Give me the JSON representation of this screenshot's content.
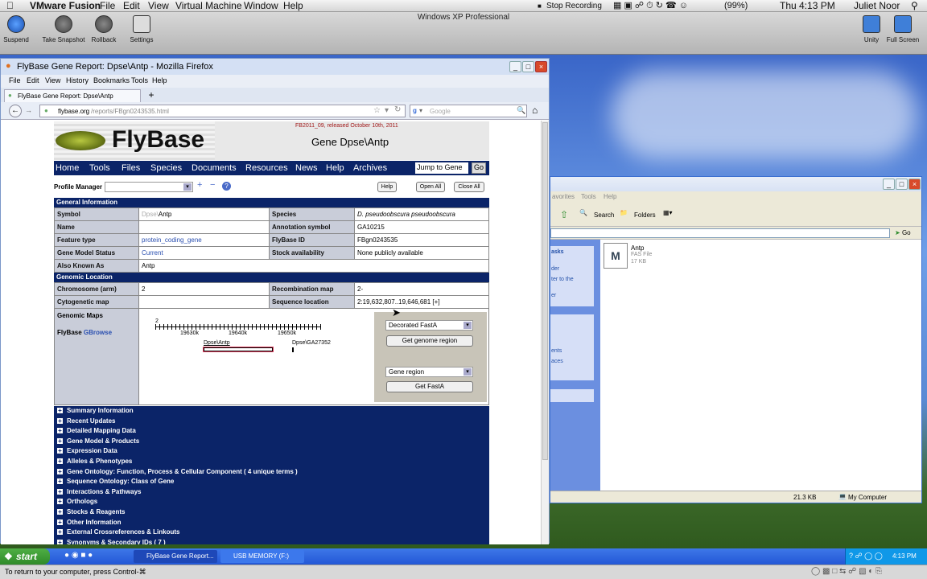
{
  "mac_menu": [
    "VMware Fusion",
    "File",
    "Edit",
    "View",
    "Virtual Machine",
    "Window",
    "Help"
  ],
  "mac_status": {
    "stop_recording": "Stop Recording",
    "battery": "(99%)",
    "clock": "Thu 4:13 PM",
    "user": "Juliet Noor"
  },
  "vm_title": "Windows XP Professional",
  "vm_toolbar": {
    "suspend": "Suspend",
    "snapshot": "Take Snapshot",
    "rollback": "Rollback",
    "settings": "Settings",
    "unity": "Unity",
    "fullscreen": "Full Screen"
  },
  "firefox": {
    "title": "FlyBase Gene Report: Dpse\\Antp - Mozilla Firefox",
    "menu": [
      "File",
      "Edit",
      "View",
      "History",
      "Bookmarks",
      "Tools",
      "Help"
    ],
    "tab": "FlyBase Gene Report: Dpse\\Antp",
    "url_host": "flybase.org",
    "url_path": "/reports/FBgn0243535.html",
    "search_placeholder": "Google"
  },
  "flybase": {
    "logo": "FlyBase",
    "release": "FB2011_09, released October 10th, 2011",
    "gene_title": "Gene Dpse\\Antp",
    "nav": [
      "Home",
      "Tools",
      "Files",
      "Species",
      "Documents",
      "Resources",
      "News",
      "Help",
      "Archives"
    ],
    "jump_to_gene": "Jump to Gene",
    "go": "Go",
    "profile_manager": "Profile Manager",
    "help_btn": "Help",
    "open_all": "Open All",
    "close_all": "Close All",
    "general_info": "General Information",
    "rows": [
      {
        "l1": "Symbol",
        "v1a": "Dpse\\",
        "v1b": "Antp",
        "l2": "Species",
        "v2": "D. pseudoobscura pseudoobscura"
      },
      {
        "l1": "Name",
        "v1a": "",
        "v1b": "",
        "l2": "Annotation symbol",
        "v2": "GA10215"
      },
      {
        "l1": "Feature type",
        "v1a": "protein_coding_gene",
        "v1b": "",
        "l2": "FlyBase ID",
        "v2": "FBgn0243535"
      },
      {
        "l1": "Gene Model Status",
        "v1a": "Current",
        "v1b": "",
        "l2": "Stock availability",
        "v2": "None publicly available"
      }
    ],
    "also_known_as_label": "Also Known As",
    "also_known_as": "Antp",
    "genomic_location": "Genomic Location",
    "chrom_label": "Chromosome (arm)",
    "chrom": "2",
    "recomb_label": "Recombination map",
    "recomb": "2-",
    "cyto_label": "Cytogenetic map",
    "seqloc_label": "Sequence location",
    "seqloc": "2:19,632,807..19,646,681 [+]",
    "genomic_maps": "Genomic Maps",
    "flybase_label": "FlyBase ",
    "gbrowse": "GBrowse",
    "map_chrom": "2",
    "ticks": [
      "19630k",
      "19640k",
      "19650k"
    ],
    "gene1": "Dpse\\Antp",
    "gene2": "Dpse\\GA27352",
    "select1": "Decorated FastA",
    "btn_genome_region": "Get genome region",
    "select2": "Gene region",
    "btn_getfasta": "Get FastA",
    "sections": [
      "Summary Information",
      "Recent Updates",
      "Detailed Mapping Data",
      "Gene Model & Products",
      "Expression Data",
      "Alleles & Phenotypes",
      "Gene Ontology: Function, Process & Cellular Component ( 4 unique terms )",
      "Sequence Ontology: Class of Gene",
      "Interactions & Pathways",
      "Orthologs",
      "Stocks & Reagents",
      "Other Information",
      "External Crossreferences & Linkouts",
      "Synonyms & Secondary IDs ( 7 )"
    ]
  },
  "explorer": {
    "menu_partial": [
      "avorites",
      "Tools",
      "Help"
    ],
    "search": "Search",
    "folders": "Folders",
    "go": "Go",
    "side_partial": [
      "asks",
      "der",
      "ter to the",
      "er",
      "ents",
      "aces"
    ],
    "file_name": "Antp",
    "file_type": "FAS File",
    "file_size": "17 KB",
    "status_size": "21.3 KB",
    "status_loc": "My Computer"
  },
  "taskbar": {
    "start": "start",
    "items": [
      "FlyBase Gene Report...",
      "USB MEMORY (F:)"
    ],
    "clock": "4:13 PM"
  },
  "statusbar": "To return to your computer, press Control-⌘"
}
